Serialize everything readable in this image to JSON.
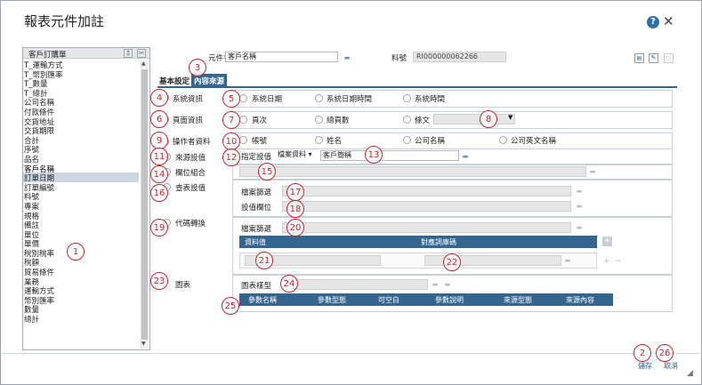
{
  "window": {
    "title": "報表元件加註"
  },
  "left_panel": {
    "header": "客戶訂購單",
    "items": [
      "T_運輸方式",
      "T_幣別匯率",
      "T_數量",
      "T_總計",
      "公司名稱",
      "付款條件",
      "交貨地址",
      "交貨期限",
      "合計",
      "序號",
      "品名",
      "客戶名稱",
      "訂單日期",
      "訂單編號",
      "料號",
      "專案",
      "規格",
      "備註",
      "單位",
      "單價",
      "稅別稅率",
      "稅額",
      "貿易條件",
      "業務",
      "運輸方式",
      "幣別匯率",
      "數量",
      "總計"
    ],
    "selected_index": 11
  },
  "header": {
    "element_name_label": "元件名",
    "element_name_value": "客戶名稱",
    "item_no_label": "料號",
    "item_no_value": "RI000000062266"
  },
  "tabs": [
    {
      "label": "基本設定"
    },
    {
      "label": "內容來源"
    }
  ],
  "sections": {
    "system": {
      "label": "系統資訊",
      "options": [
        "系統日期",
        "系統日期時間",
        "系統時間"
      ]
    },
    "page": {
      "label": "頁面資訊",
      "options": [
        "頁次",
        "總頁數",
        "條文"
      ]
    },
    "operator": {
      "label": "操作者資料",
      "options": [
        "帳號",
        "姓名",
        "公司名稱",
        "公司英文名稱"
      ]
    },
    "source": {
      "label": "來源設值",
      "assign_label": "指定設值",
      "source_select": "檔案資料 ▾",
      "source_field": "客戶簡稱"
    },
    "field_combo": {
      "label": "欄位組合"
    },
    "lookup": {
      "label": "查表設值",
      "filter_label": "檔案篩選",
      "value_field_label": "設值欄位"
    },
    "code_convert": {
      "label": "代碼轉換",
      "filter_label": "檔案篩選",
      "col_data_value": "資料值",
      "col_mapping": "對應詞庫碼"
    },
    "chart": {
      "label": "圖表",
      "template_label": "圖表樣型",
      "cols": [
        "參數名稱",
        "參數型態",
        "可空白",
        "參數說明",
        "來源型態",
        "來源內容"
      ]
    }
  },
  "footer": {
    "save": "儲存",
    "cancel": "取消"
  },
  "callouts": [
    "1",
    "2",
    "3",
    "4",
    "5",
    "6",
    "7",
    "8",
    "9",
    "10",
    "11",
    "12",
    "13",
    "14",
    "15",
    "16",
    "17",
    "18",
    "19",
    "20",
    "21",
    "22",
    "23",
    "24",
    "25",
    "26"
  ],
  "colors": {
    "accent": "#33658f",
    "callout": "#d0202a"
  }
}
